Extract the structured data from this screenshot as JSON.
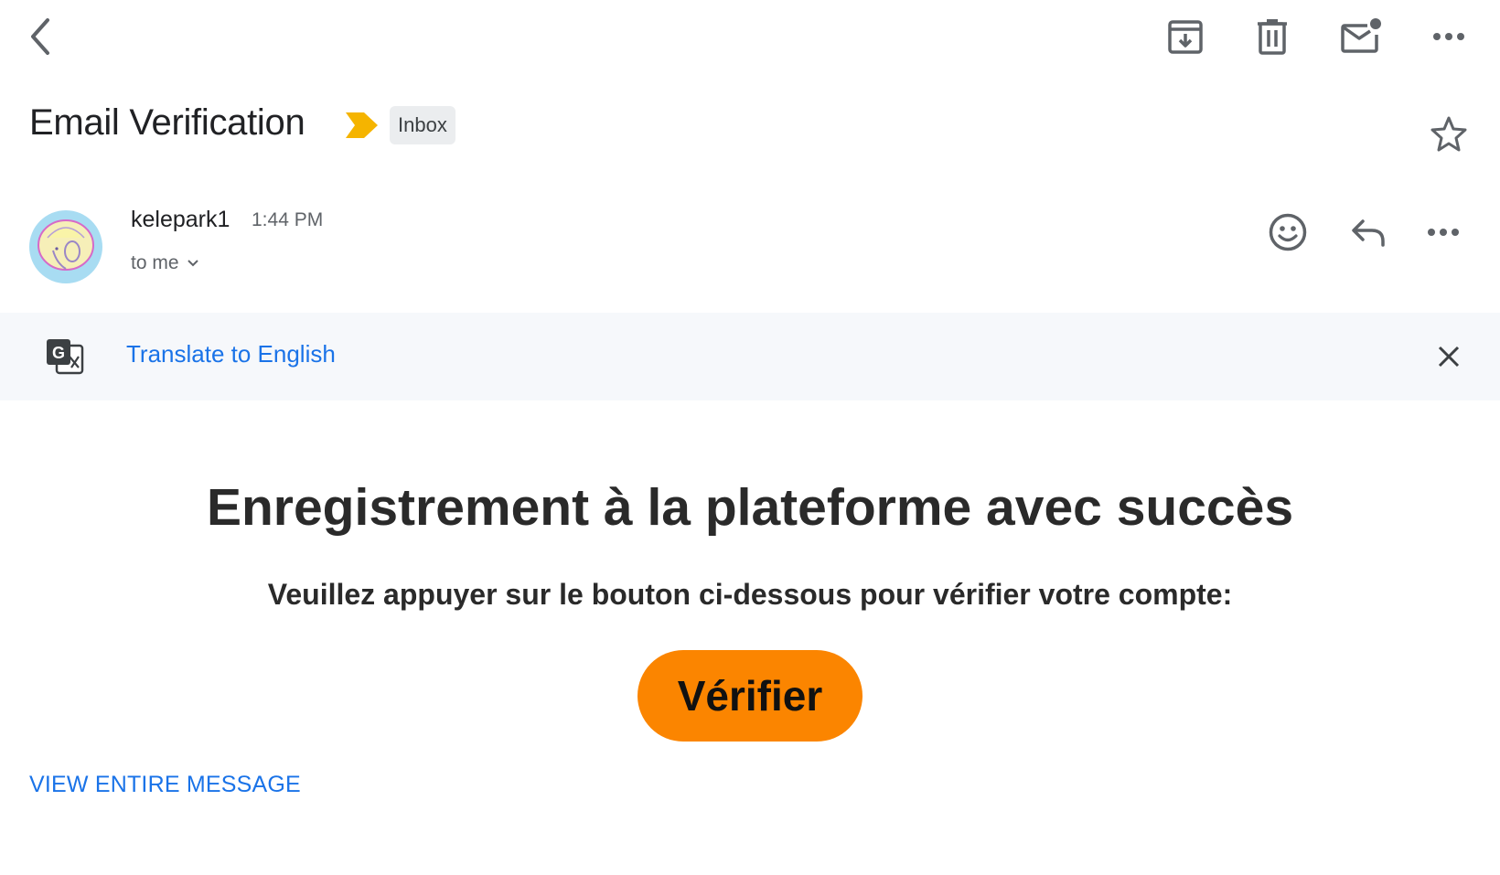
{
  "toolbar": {
    "back_icon": "arrow-back-icon",
    "archive_icon": "archive-icon",
    "delete_icon": "trash-icon",
    "mark_unread_icon": "mail-unread-icon",
    "more_icon": "more-horizontal-icon"
  },
  "message": {
    "subject": "Email Verification",
    "importance_marker_color": "#f5b400",
    "label": "Inbox",
    "star_icon": "star-outline-icon"
  },
  "sender": {
    "name": "kelepark1",
    "time": "1:44 PM",
    "recipient": "to me",
    "avatar_bg": "#a8dcf2"
  },
  "translate": {
    "icon": "google-translate-icon",
    "link": "Translate to English",
    "close_icon": "close-icon"
  },
  "email_body": {
    "heading": "Enregistrement à la plateforme avec succès",
    "instruction": "Veuillez appuyer sur le bouton ci-dessous pour vérifier votre compte:",
    "button_label": "Vérifier",
    "button_color": "#fb8500"
  },
  "footer": {
    "view_entire": "VIEW ENTIRE MESSAGE"
  },
  "colors": {
    "link_blue": "#1a73e8",
    "icon_gray": "#5f6368",
    "translate_bar_bg": "#f6f8fb"
  }
}
